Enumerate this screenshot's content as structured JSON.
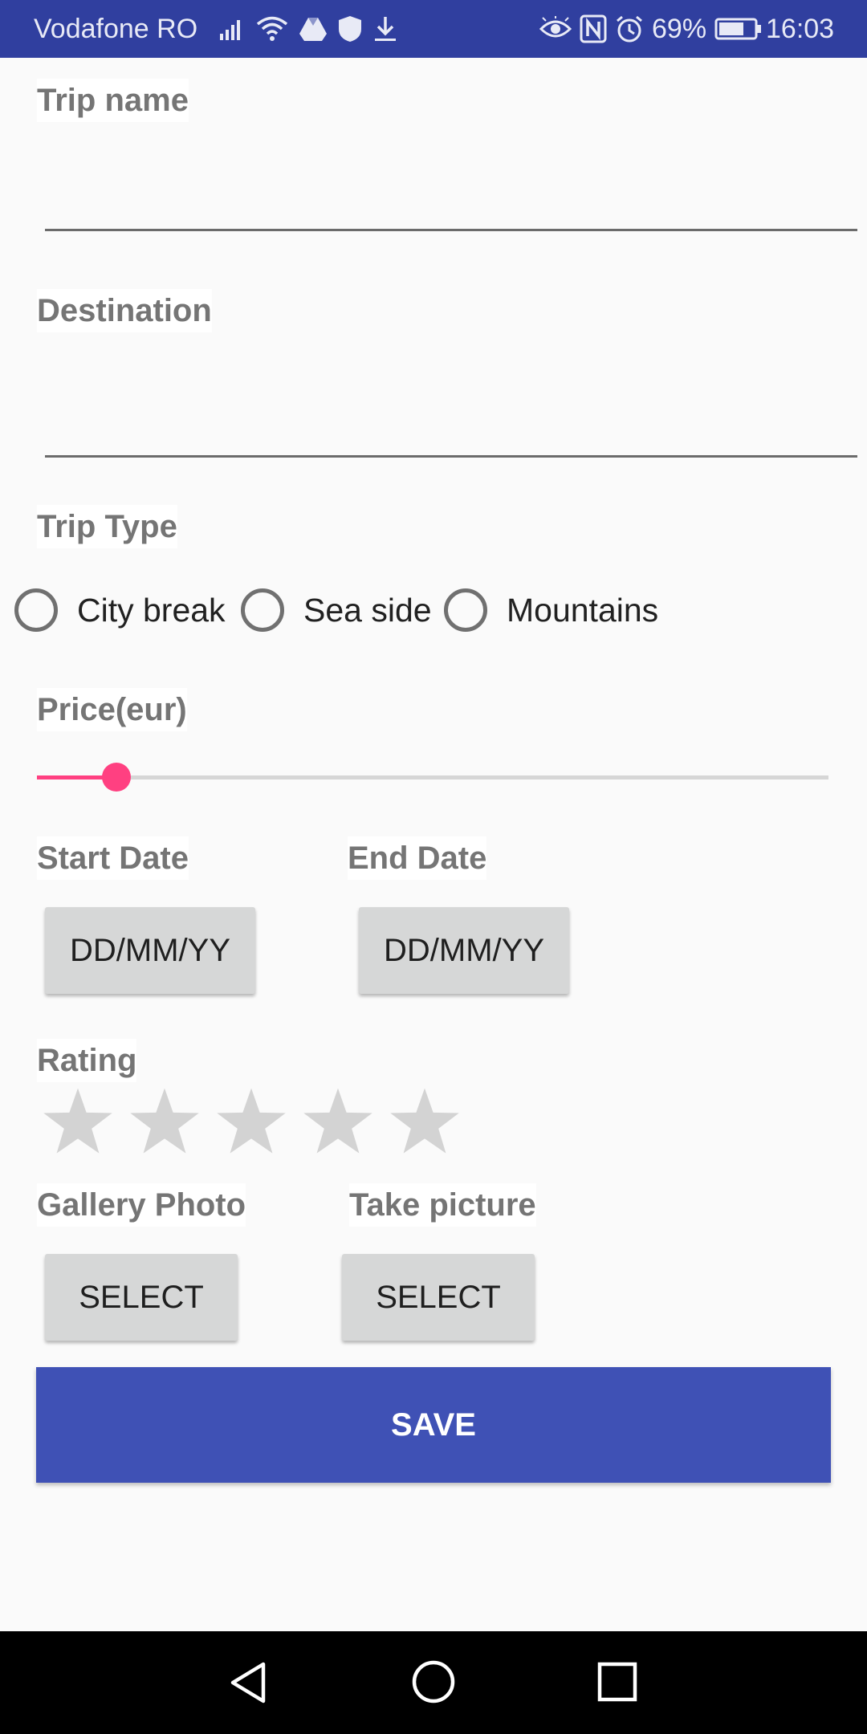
{
  "status_bar": {
    "carrier": "Vodafone RO",
    "battery": "69%",
    "time": "16:03",
    "left_icons": [
      "signal-icon",
      "wifi-icon",
      "drive-icon",
      "shield-icon",
      "download-icon"
    ],
    "right_icons": [
      "eye-icon",
      "nfc-icon",
      "alarm-icon",
      "battery-icon"
    ]
  },
  "form": {
    "trip_name_label": "Trip name",
    "trip_name_value": "",
    "destination_label": "Destination",
    "destination_value": "",
    "trip_type_label": "Trip Type",
    "trip_types": [
      "City break",
      "Sea side",
      "Mountains"
    ],
    "price_label": "Price(eur)",
    "price_fraction": 0.1,
    "start_date_label": "Start Date",
    "start_date_value": "DD/MM/YY",
    "end_date_label": "End Date",
    "end_date_value": "DD/MM/YY",
    "rating_label": "Rating",
    "rating_value": 0,
    "rating_max": 5,
    "gallery_label": "Gallery Photo",
    "gallery_button": "SELECT",
    "take_picture_label": "Take picture",
    "take_picture_button": "SELECT",
    "save_button": "SAVE"
  },
  "colors": {
    "status_bar": "#303f9f",
    "accent": "#ff4081",
    "primary": "#3f51b5"
  },
  "nav_bar": {
    "icons": [
      "back-icon",
      "home-icon",
      "recents-icon"
    ]
  }
}
